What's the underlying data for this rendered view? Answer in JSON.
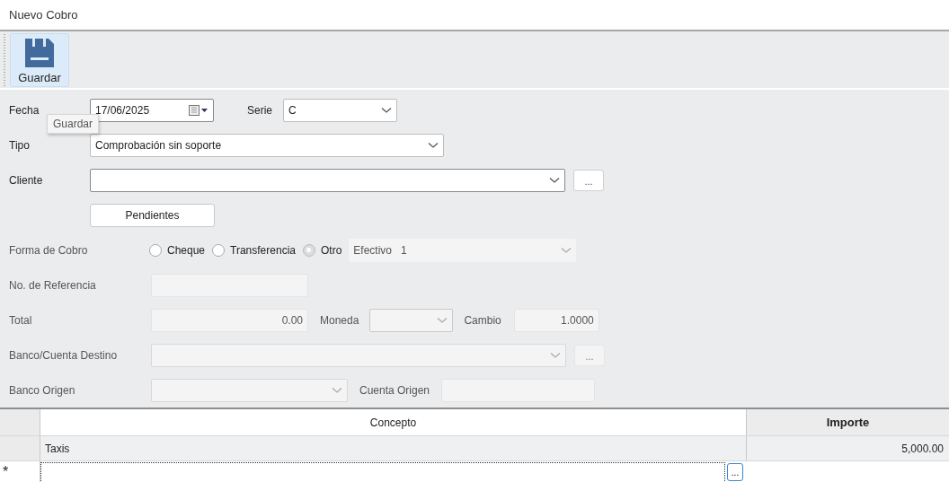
{
  "window": {
    "title": "Nuevo Cobro"
  },
  "toolbar": [
    {
      "label": "Guardar",
      "highlighted": true
    }
  ],
  "tooltip": "Guardar",
  "fecha": {
    "label": "Fecha",
    "value": "17/06/2025"
  },
  "serie": {
    "label": "Serie",
    "value": "C"
  },
  "tipo": {
    "label": "Tipo",
    "value": "Comprobación sin soporte"
  },
  "cliente": {
    "label": "Cliente",
    "browse": "..."
  },
  "pendientes_button": "Pendientes",
  "payment": {
    "disabled": true,
    "forma_de_cobro": {
      "label": "Forma de Cobro",
      "options": [
        {
          "label": "Cheque",
          "selected": false
        },
        {
          "label": "Transferencia",
          "selected": false
        },
        {
          "label": "Otro",
          "selected": true
        }
      ],
      "method": "Efectivo",
      "method_code": "1"
    },
    "referencia": {
      "label": "No. de Referencia"
    },
    "total": {
      "label": "Total",
      "value": "0.00"
    },
    "moneda": {
      "label": "Moneda"
    },
    "cambio": {
      "label": "Cambio",
      "value": "1.0000"
    },
    "banco_destino": {
      "label": "Banco/Cuenta Destino",
      "browse": "..."
    },
    "banco_origen": {
      "label": "Banco Origen"
    },
    "cuenta_origen": {
      "label": "Cuenta Origen"
    }
  },
  "table": {
    "columns": [
      "Concepto",
      "Importe"
    ],
    "rows": [
      {
        "concepto": "Taxis",
        "importe": "5,000.00"
      }
    ],
    "new_row": {
      "marker": "*",
      "browse": "..."
    }
  }
}
